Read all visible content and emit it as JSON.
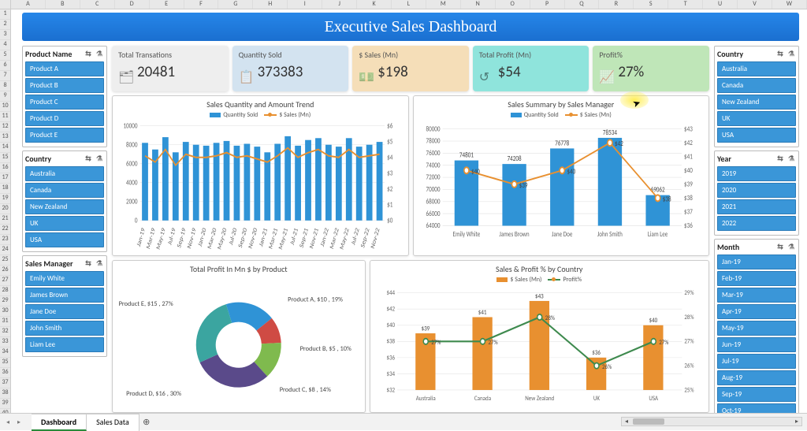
{
  "columns": [
    "A",
    "B",
    "C",
    "D",
    "E",
    "F",
    "G",
    "H",
    "I",
    "J",
    "K",
    "L",
    "M",
    "N",
    "O",
    "P",
    "Q",
    "R",
    "S",
    "T",
    "U",
    "V",
    "W"
  ],
  "rows": 40,
  "title": "Executive Sales Dashboard",
  "slicers_left": [
    {
      "title": "Product Name",
      "items": [
        "Product A",
        "Product B",
        "Product C",
        "Product D",
        "Product E"
      ]
    },
    {
      "title": "Country",
      "items": [
        "Australia",
        "Canada",
        "New Zealand",
        "UK",
        "USA"
      ]
    },
    {
      "title": "Sales Manager",
      "items": [
        "Emily White",
        "James Brown",
        "Jane Doe",
        "John Smith",
        "Liam Lee"
      ]
    }
  ],
  "slicers_right": [
    {
      "title": "Country",
      "items": [
        "Australia",
        "Canada",
        "New Zealand",
        "UK",
        "USA"
      ]
    },
    {
      "title": "Year",
      "items": [
        "2019",
        "2020",
        "2021",
        "2022"
      ]
    },
    {
      "title": "Month",
      "items": [
        "Jan-19",
        "Feb-19",
        "Mar-19",
        "Apr-19",
        "May-19",
        "Jun-19",
        "Jul-19",
        "Aug-19",
        "Sep-19",
        "Oct-19"
      ]
    }
  ],
  "kpis": [
    {
      "label": "Total Transations",
      "value": "20481",
      "class": "kpi1",
      "icon": "🗂"
    },
    {
      "label": "Quantity Sold",
      "value": "373383",
      "class": "kpi2",
      "icon": "📋"
    },
    {
      "label": "$ Sales (Mn)",
      "value": "$198",
      "class": "kpi3",
      "icon": "💵"
    },
    {
      "label": "Total Profit (Mn)",
      "value": "$54",
      "class": "kpi4",
      "icon": "↺"
    },
    {
      "label": "Profit%",
      "value": "27%",
      "class": "kpi5",
      "icon": "📈"
    }
  ],
  "chart_data": [
    {
      "id": "trend",
      "title": "Sales Quantity and Amount Trend",
      "type": "bar+line",
      "legend": [
        "Quantity Sold",
        "$ Sales (Mn)"
      ],
      "x": [
        "Jan-19",
        "Mar-19",
        "May-19",
        "Jul-19",
        "Sep-19",
        "Nov-19",
        "Jan-20",
        "Mar-20",
        "May-20",
        "Jul-20",
        "Sep-20",
        "Nov-20",
        "Jan-21",
        "Mar-21",
        "May-21",
        "Jul-21",
        "Sep-21",
        "Nov-21",
        "Jan-22",
        "Mar-22",
        "May-22",
        "Jul-22",
        "Sep-22",
        "Nov-22"
      ],
      "y1_ticks": [
        0,
        2000,
        4000,
        6000,
        8000,
        10000
      ],
      "y2_ticks": [
        "$0",
        "$1",
        "$2",
        "$3",
        "$4",
        "$5",
        "$6"
      ],
      "bars": [
        8200,
        7500,
        8800,
        7200,
        8300,
        8000,
        7900,
        8200,
        8400,
        7900,
        8100,
        7800,
        7200,
        8100,
        8900,
        7900,
        8500,
        8700,
        8000,
        7800,
        8700,
        7800,
        8000,
        8300
      ],
      "line": [
        4.1,
        3.7,
        4.5,
        3.5,
        4.2,
        4.0,
        4.0,
        4.1,
        4.3,
        4.0,
        4.1,
        3.9,
        3.7,
        4.1,
        4.6,
        4.0,
        4.3,
        4.5,
        4.1,
        4.0,
        4.5,
        4.0,
        4.1,
        4.2
      ]
    },
    {
      "id": "manager",
      "title": "Sales Summary by Sales Manager",
      "type": "bar+line",
      "legend": [
        "Quantity Sold",
        "$ Sales (Mn)"
      ],
      "categories": [
        "Emily White",
        "James Brown",
        "Jane Doe",
        "John Smith",
        "Liam Lee"
      ],
      "y1_ticks": [
        64000,
        66000,
        68000,
        70000,
        72000,
        74000,
        76000,
        78000,
        80000
      ],
      "y2_ticks": [
        "$36",
        "$37",
        "$38",
        "$39",
        "$40",
        "$41",
        "$42",
        "$43"
      ],
      "bars": [
        74801,
        74208,
        76778,
        78534,
        69062
      ],
      "bar_labels": [
        "74801",
        "74208",
        "76778",
        "78534",
        "69062"
      ],
      "line": [
        40,
        39,
        40,
        42,
        38
      ],
      "line_labels": [
        "$40",
        "$39",
        "$40",
        "$42",
        "$38"
      ]
    },
    {
      "id": "donut",
      "title": "Total Profit In Mn $ by Product",
      "type": "pie",
      "slices": [
        {
          "label": "Product A, $10 , 19%",
          "value": 19,
          "color": "#2f93d6"
        },
        {
          "label": "Product B, $5 , 10%",
          "value": 10,
          "color": "#cf4b44"
        },
        {
          "label": "Product C, $8 , 14%",
          "value": 14,
          "color": "#7fba4e"
        },
        {
          "label": "Product D, $16 , 30%",
          "value": 30,
          "color": "#5a4a8a"
        },
        {
          "label": "Product E, $15 , 27%",
          "value": 27,
          "color": "#3ba5a0"
        }
      ]
    },
    {
      "id": "country",
      "title": "Sales & Profit % by Country",
      "type": "bar+line",
      "legend": [
        "$ Sales (Mn)",
        "Profit%"
      ],
      "categories": [
        "Australia",
        "Canada",
        "New Zealand",
        "UK",
        "USA"
      ],
      "y1_ticks": [
        "$32",
        "$34",
        "$36",
        "$38",
        "$40",
        "$42",
        "$44"
      ],
      "y2_ticks": [
        "25%",
        "26%",
        "27%",
        "28%",
        "29%"
      ],
      "bars": [
        39,
        41,
        43,
        36,
        40
      ],
      "bar_labels": [
        "$39",
        "$41",
        "$43",
        "$36",
        "$40"
      ],
      "line": [
        27,
        27,
        28,
        26,
        27
      ],
      "line_labels": [
        "27%",
        "27%",
        "28%",
        "26%",
        "27%"
      ]
    }
  ],
  "sheet_tabs": [
    "Dashboard",
    "Sales Data"
  ],
  "active_tab": 0
}
